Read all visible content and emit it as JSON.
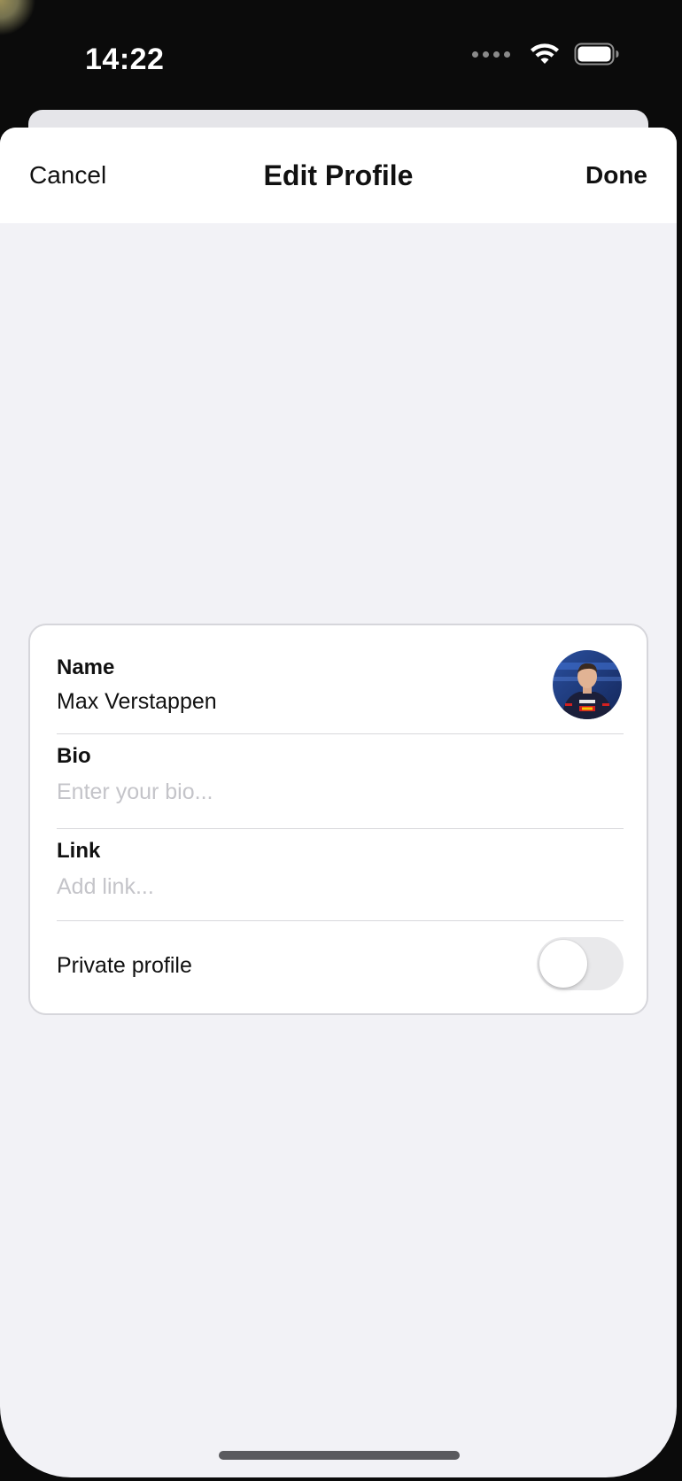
{
  "status_bar": {
    "time": "14:22",
    "icons": [
      "signal-dots-icon",
      "wifi-icon",
      "battery-icon"
    ]
  },
  "nav": {
    "cancel_label": "Cancel",
    "title": "Edit Profile",
    "done_label": "Done"
  },
  "profile": {
    "name_label": "Name",
    "name_value": "Max Verstappen",
    "avatar_icon": "avatar-photo",
    "bio_label": "Bio",
    "bio_value": "",
    "bio_placeholder": "Enter your bio...",
    "link_label": "Link",
    "link_value": "",
    "link_placeholder": "Add link...",
    "private_label": "Private profile",
    "private_enabled": false
  },
  "colors": {
    "sheet_background": "#f2f2f6",
    "card_background": "#ffffff",
    "toggle_off": "#e9e9eb",
    "placeholder": "#c4c4c9"
  }
}
